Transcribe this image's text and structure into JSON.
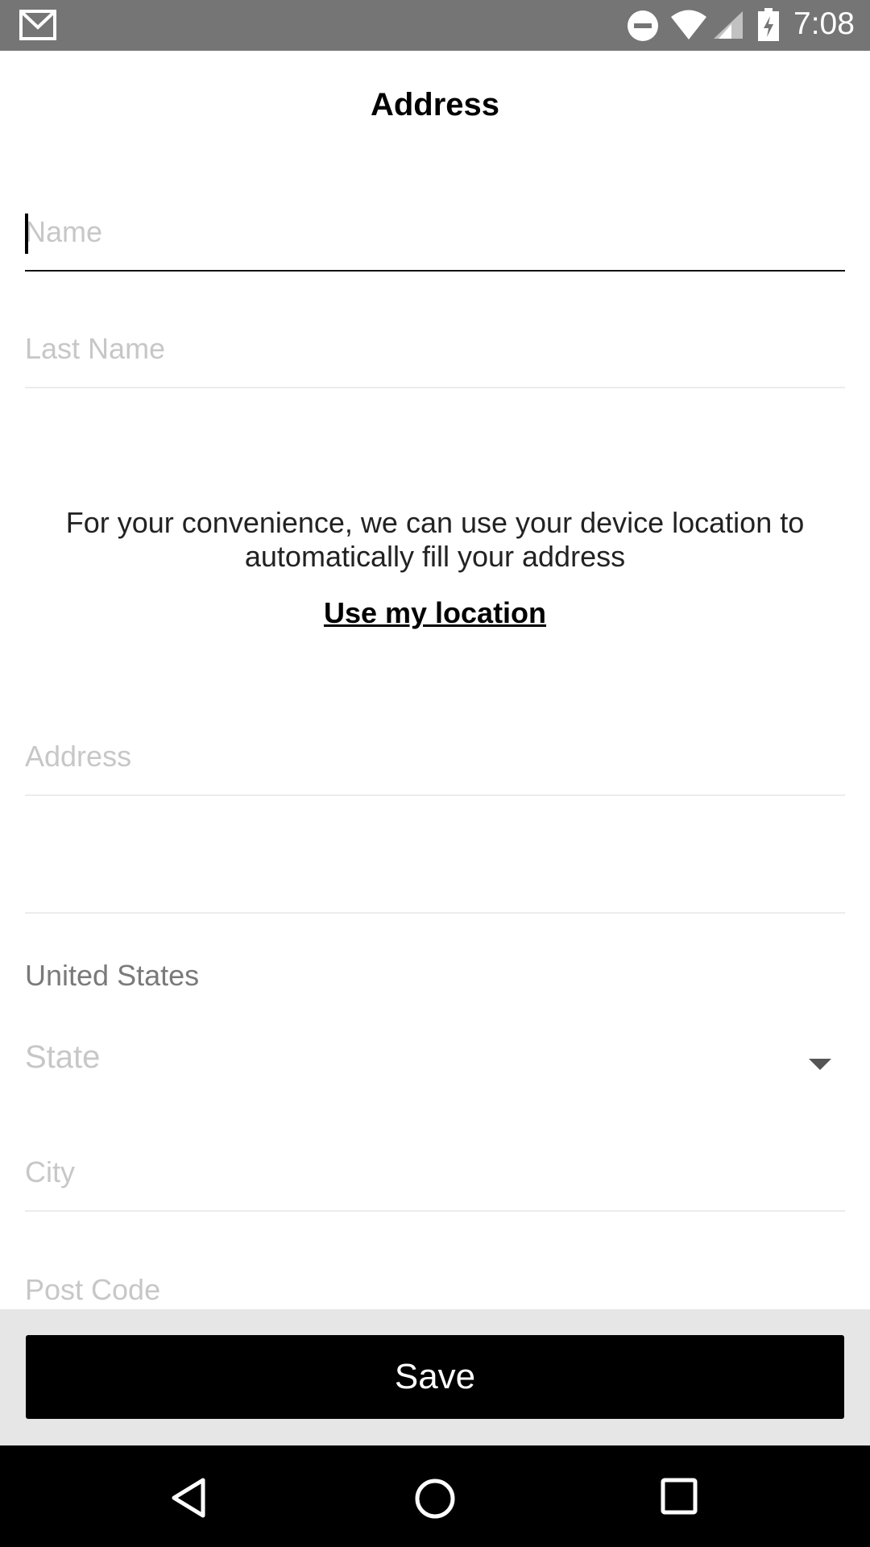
{
  "status_bar": {
    "time": "7:08",
    "icons": [
      "gmail-icon",
      "do-not-disturb-icon",
      "wifi-icon",
      "signal-icon",
      "battery-charging-icon"
    ]
  },
  "header": {
    "title": "Address"
  },
  "form": {
    "name": {
      "placeholder": "Name"
    },
    "last_name": {
      "placeholder": "Last Name"
    },
    "location_info": "For your convenience, we can use your device location to automatically fill your address",
    "use_location_label": "Use my location",
    "address": {
      "placeholder": "Address"
    },
    "address2": {
      "placeholder": ""
    },
    "country": "United States",
    "state": {
      "placeholder": "State"
    },
    "city": {
      "placeholder": "City"
    },
    "post_code": {
      "placeholder": "Post Code"
    }
  },
  "actions": {
    "save_label": "Save"
  },
  "nav_bar": {
    "icons": [
      "back-icon",
      "home-icon",
      "recent-apps-icon"
    ]
  }
}
